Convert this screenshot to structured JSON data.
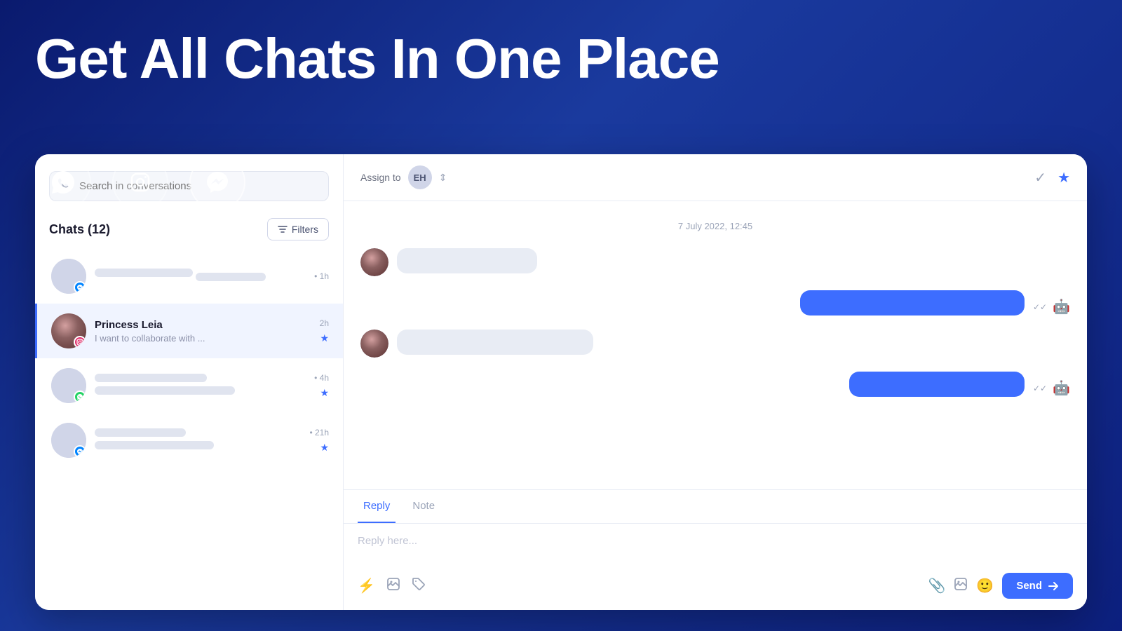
{
  "hero": {
    "title": "Get All Chats In One Place"
  },
  "platforms": [
    {
      "id": "whatsapp",
      "icon": "💬",
      "active": false
    },
    {
      "id": "instagram",
      "icon": "📷",
      "active": false
    },
    {
      "id": "messenger",
      "icon": "💬",
      "active": true
    }
  ],
  "sidebar": {
    "search_placeholder": "Search in conversations",
    "chats_label": "Chats (12)",
    "filters_label": "Filters"
  },
  "chat_list": [
    {
      "id": 1,
      "name": null,
      "preview": null,
      "time": "1h",
      "platform": "messenger",
      "starred": false,
      "active": false
    },
    {
      "id": 2,
      "name": "Princess Leia",
      "preview": "I want to collaborate with ...",
      "time": "2h",
      "platform": "instagram",
      "starred": true,
      "active": true
    },
    {
      "id": 3,
      "name": null,
      "preview": null,
      "time": "4h",
      "platform": "whatsapp",
      "starred": true,
      "active": false
    },
    {
      "id": 4,
      "name": null,
      "preview": null,
      "time": "21h",
      "platform": "messenger",
      "starred": true,
      "active": false
    }
  ],
  "chat_header": {
    "assign_label": "Assign to",
    "assignee_initials": "EH"
  },
  "messages": {
    "date_label": "7 July 2022, 12:45"
  },
  "reply_area": {
    "tab_reply": "Reply",
    "tab_note": "Note",
    "placeholder": "Reply here...",
    "send_label": "Send"
  }
}
